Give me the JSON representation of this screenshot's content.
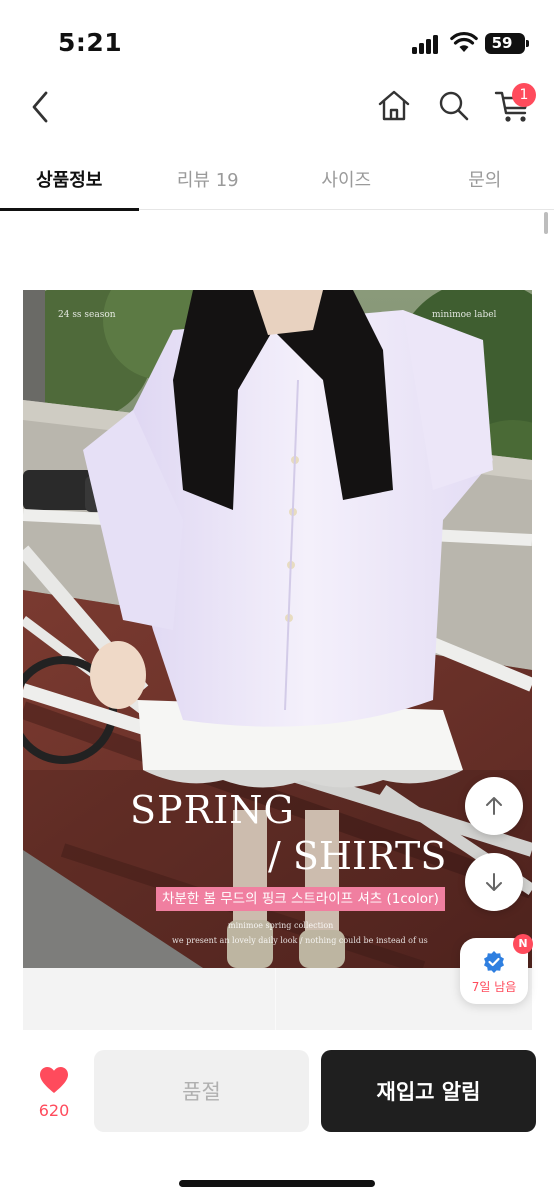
{
  "status_bar": {
    "time": "5:21",
    "battery": "59"
  },
  "nav": {
    "cart_count": "1",
    "icons": [
      "back-icon",
      "home-icon",
      "search-icon",
      "cart-icon"
    ]
  },
  "tabs": [
    {
      "label": "상품정보",
      "active": true
    },
    {
      "label": "리뷰 19",
      "active": false
    },
    {
      "label": "사이즈",
      "active": false
    },
    {
      "label": "문의",
      "active": false
    }
  ],
  "product_image": {
    "overlay_tl": "24 ss season",
    "overlay_tr": "minimoe label",
    "title_line1": "SPRING",
    "title_line2": "/ SHIRTS",
    "caption": "차분한 봄 무드의 핑크 스트라이프 셔츠 (1color)",
    "small_line1": "minimoe spring collection",
    "small_line2": "we present an lovely daily look / nothing could be instead of us"
  },
  "floating": {
    "notice_badge": "N",
    "notice_text": "7일 남음"
  },
  "bottom_bar": {
    "like_count": "620",
    "soldout_label": "품절",
    "restock_label": "재입고 알림"
  },
  "colors": {
    "accent": "#ff4b5c",
    "dark_button": "#1f1f1f",
    "disabled_button": "#f0f0f0",
    "caption_pink": "#f07fa0",
    "verified_blue": "#2f7fe0"
  }
}
